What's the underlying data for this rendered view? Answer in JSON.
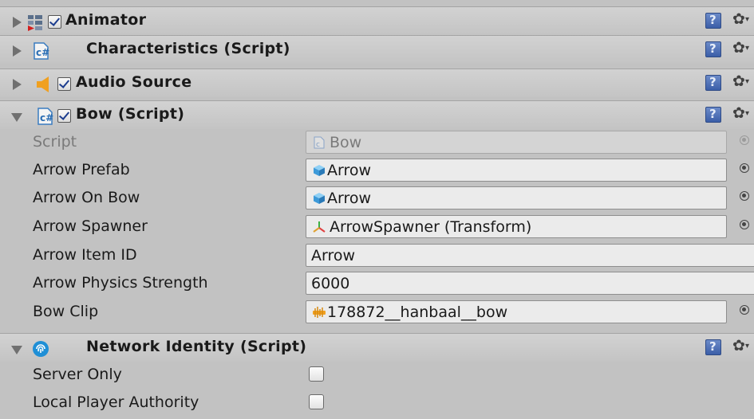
{
  "components": [
    {
      "title": "Animator",
      "icon": "animator-icon",
      "expanded": false,
      "has_checkbox": true,
      "checked": true
    },
    {
      "title": "Characteristics (Script)",
      "icon": "csharp-script-icon",
      "expanded": false,
      "has_checkbox": false
    },
    {
      "title": "Audio Source",
      "icon": "audio-source-icon",
      "expanded": false,
      "has_checkbox": true,
      "checked": true
    },
    {
      "title": "Bow (Script)",
      "icon": "csharp-script-icon",
      "expanded": true,
      "has_checkbox": true,
      "checked": true
    },
    {
      "title": "Network Identity (Script)",
      "icon": "network-identity-icon",
      "expanded": true,
      "has_checkbox": false
    }
  ],
  "bow": {
    "script": {
      "label": "Script",
      "value": "Bow",
      "icon": "script-asset-icon"
    },
    "arrow_prefab": {
      "label": "Arrow Prefab",
      "value": "Arrow",
      "icon": "prefab-cube-icon"
    },
    "arrow_on_bow": {
      "label": "Arrow On Bow",
      "value": "Arrow",
      "icon": "prefab-cube-icon"
    },
    "arrow_spawner": {
      "label": "Arrow Spawner",
      "value": "ArrowSpawner (Transform)",
      "icon": "transform-icon"
    },
    "arrow_item_id": {
      "label": "Arrow Item ID",
      "value": "Arrow"
    },
    "arrow_physics_strength": {
      "label": "Arrow Physics Strength",
      "value": "6000"
    },
    "bow_clip": {
      "label": "Bow Clip",
      "value": "178872__hanbaal__bow",
      "icon": "audio-clip-icon"
    }
  },
  "network_identity": {
    "server_only": {
      "label": "Server Only",
      "checked": false
    },
    "local_player_authority": {
      "label": "Local Player Authority",
      "checked": false
    }
  },
  "colors": {
    "panel_bg": "#c2c2c2",
    "field_bg": "#ebebeb",
    "help_icon": "#3b5ea8",
    "audio_icon": "#f0a020"
  }
}
